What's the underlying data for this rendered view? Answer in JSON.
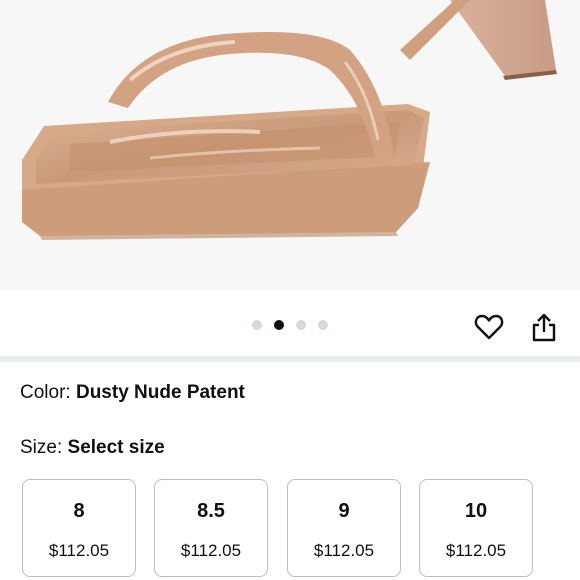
{
  "product": {
    "image_alt": "Dusty nude patent platform sandal",
    "gallery": {
      "total": 4,
      "active_index": 1
    },
    "actions": {
      "wishlist_icon": "heart-icon",
      "share_icon": "share-icon"
    }
  },
  "color": {
    "label": "Color: ",
    "value": "Dusty Nude Patent"
  },
  "size": {
    "label": "Size: ",
    "value": "Select size",
    "options": [
      {
        "size": "8",
        "price": "$112.05"
      },
      {
        "size": "8.5",
        "price": "$112.05"
      },
      {
        "size": "9",
        "price": "$112.05"
      },
      {
        "size": "10",
        "price": "$112.05"
      }
    ]
  },
  "colors": {
    "dot_active": "#0f1111",
    "dot_inactive": "#d5d9d9",
    "shoe": "#d3a686"
  }
}
